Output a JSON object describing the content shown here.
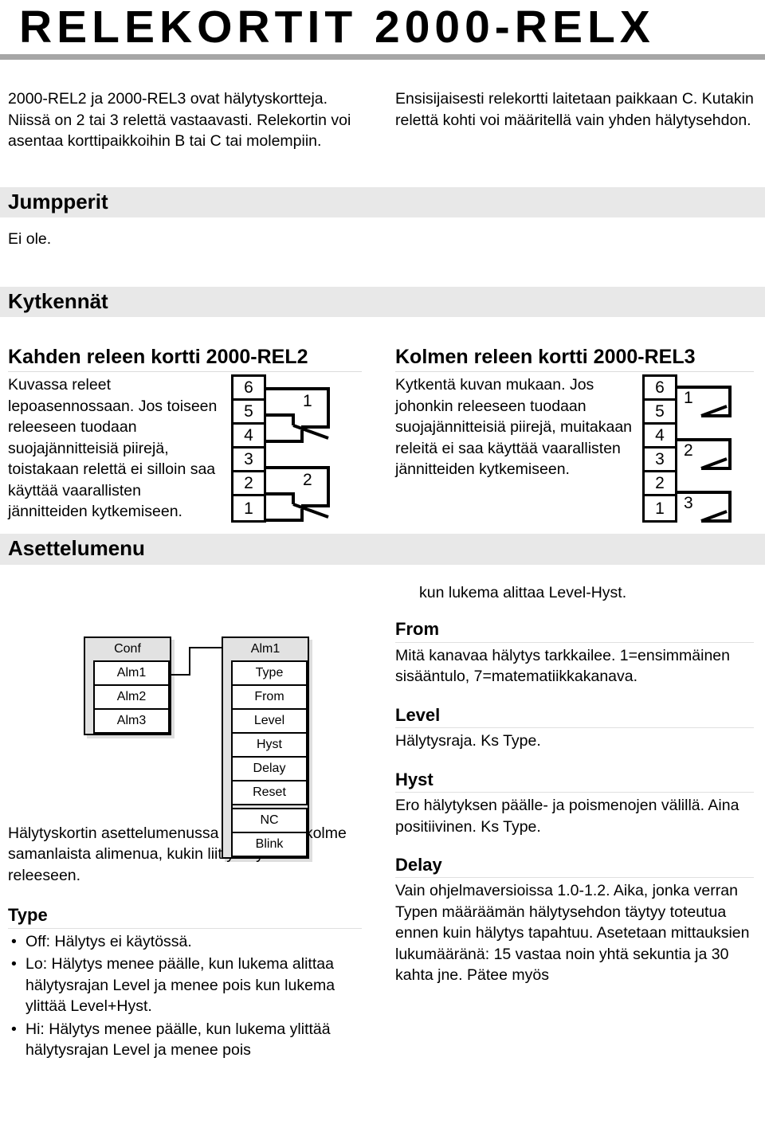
{
  "title": "RELEKORTIT 2000-RELX",
  "intro": {
    "left": "2000-REL2 ja 2000-REL3 ovat hälytyskortteja. Niissä on 2 tai 3 relettä vastaavasti. Relekortin voi asentaa korttipaikkoihin B tai C tai molempiin.",
    "right": "Ensisijaisesti relekortti laitetaan paikkaan C. Kutakin relettä kohti voi määritellä vain yhden hälytysehdon."
  },
  "sections": {
    "jumpperit": {
      "heading": "Jumpperit",
      "body": "Ei ole."
    },
    "kytkennat": {
      "heading": "Kytkennät"
    },
    "asettelumenu": {
      "heading": "Asettelumenu"
    }
  },
  "rel2": {
    "heading": "Kahden releen kortti 2000-REL2",
    "body": "Kuvassa releet lepoasennossaan. Jos toiseen releeseen tuodaan suojajännitteisiä piirejä, toistakaan relettä ei silloin saa käyttää vaarallisten jännitteiden kytkemiseen.",
    "terminals": [
      "6",
      "5",
      "4",
      "3",
      "2",
      "1"
    ],
    "contacts": [
      "1",
      "2"
    ]
  },
  "rel3": {
    "heading": "Kolmen releen kortti 2000-REL3",
    "body": "Kytkentä kuvan mukaan. Jos johonkin releeseen tuodaan suojajännitteisiä piirejä, muitakaan releitä ei saa käyttää vaarallisten jännitteiden kytkemiseen.",
    "terminals": [
      "6",
      "5",
      "4",
      "3",
      "2",
      "1"
    ],
    "contacts": [
      "1",
      "2",
      "3"
    ]
  },
  "menu_tree": {
    "conf": {
      "title": "Conf",
      "items": [
        "Alm1",
        "Alm2",
        "Alm3"
      ]
    },
    "alm1": {
      "title": "Alm1",
      "items": [
        "Type",
        "From",
        "Level",
        "Hyst",
        "Delay",
        "Reset",
        "NC",
        "Blink"
      ]
    }
  },
  "menu_note": "Hälytyskortin asettelumenussa on kaksi tai kolme samanlaista alimenua, kukin liittyen yhteen releeseen.",
  "params": {
    "type": {
      "heading": "Type",
      "bullets": [
        "Off: Hälytys ei käytössä.",
        "Lo: Hälytys menee päälle, kun lukema alittaa hälytysrajan Level ja menee pois kun lukema ylittää Level+Hyst.",
        "Hi: Hälytys menee päälle, kun lukema ylittää hälytysrajan Level ja menee pois"
      ]
    },
    "type_cont": "kun lukema alittaa Level-Hyst.",
    "from": {
      "heading": "From",
      "body": "Mitä kanavaa hälytys tarkkailee. 1=ensimmäinen sisääntulo, 7=matematiikkakanava."
    },
    "level": {
      "heading": "Level",
      "body": "Hälytysraja. Ks Type."
    },
    "hyst": {
      "heading": "Hyst",
      "body": "Ero hälytyksen päälle- ja poismenojen välillä. Aina positiivinen. Ks Type."
    },
    "delay": {
      "heading": "Delay",
      "body": "Vain ohjelmaversioissa 1.0-1.2. Aika, jonka verran Typen määräämän hälytysehdon täytyy toteutua ennen kuin hälytys tapahtuu. Asetetaan mittauksien lukumääränä: 15 vastaa noin yhtä sekuntia ja 30 kahta jne. Pätee myös"
    }
  }
}
